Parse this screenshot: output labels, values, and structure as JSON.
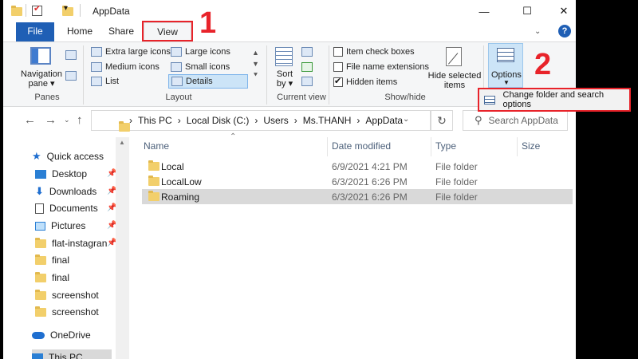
{
  "window": {
    "title": "AppData",
    "controls": {
      "minimize": "—",
      "maximize": "☐",
      "close": "✕"
    }
  },
  "tabs": [
    {
      "label": "File"
    },
    {
      "label": "Home"
    },
    {
      "label": "Share"
    },
    {
      "label": "View"
    }
  ],
  "ribbon": {
    "panes": {
      "nav_pane_line1": "Navigation",
      "nav_pane_line2": "pane",
      "group": "Panes"
    },
    "layout": {
      "items": [
        "Extra large icons",
        "Large icons",
        "Medium icons",
        "Small icons",
        "List",
        "Details"
      ],
      "group": "Layout"
    },
    "current_view": {
      "sort_line1": "Sort",
      "sort_line2": "by",
      "group": "Current view"
    },
    "show_hide": {
      "item_check_boxes": "Item check boxes",
      "file_name_extensions": "File name extensions",
      "hidden_items": "Hidden items",
      "hide_selected_line1": "Hide selected",
      "hide_selected_line2": "items",
      "group": "Show/hide"
    },
    "options": {
      "label": "Options"
    }
  },
  "menu": {
    "change_folder": "Change folder and search options"
  },
  "address": {
    "crumbs": [
      "This PC",
      "Local Disk (C:)",
      "Users",
      "Ms.THANH",
      "AppData"
    ],
    "separator": "›",
    "search_placeholder": "Search AppData"
  },
  "sidebar": {
    "quick_access": "Quick access",
    "items": [
      {
        "label": "Desktop"
      },
      {
        "label": "Downloads"
      },
      {
        "label": "Documents"
      },
      {
        "label": "Pictures"
      },
      {
        "label": "flat-instagran"
      },
      {
        "label": "final"
      },
      {
        "label": "final"
      },
      {
        "label": "screenshot"
      },
      {
        "label": "screenshot"
      }
    ],
    "onedrive": "OneDrive",
    "this_pc": "This PC"
  },
  "columns": {
    "name": "Name",
    "date": "Date modified",
    "type": "Type",
    "size": "Size"
  },
  "files": [
    {
      "name": "Local",
      "date": "6/9/2021 4:21 PM",
      "type": "File folder"
    },
    {
      "name": "LocalLow",
      "date": "6/3/2021 6:26 PM",
      "type": "File folder"
    },
    {
      "name": "Roaming",
      "date": "6/3/2021 6:26 PM",
      "type": "File folder"
    }
  ],
  "annotations": {
    "step1": "1",
    "step2": "2"
  },
  "colors": {
    "accent": "#1f5fb5",
    "highlight": "#e8232a",
    "folder": "#f2cf6b",
    "selection": "#d9d9d9"
  }
}
